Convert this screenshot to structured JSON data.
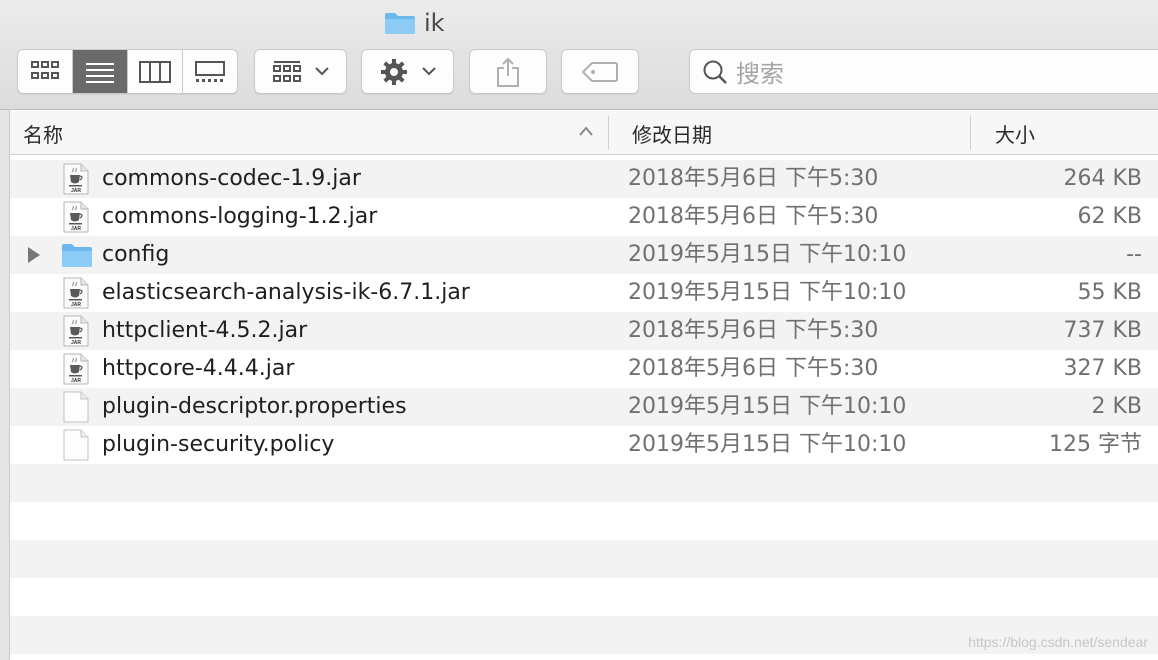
{
  "window": {
    "title": "ik",
    "title_icon": "folder-icon"
  },
  "toolbar": {
    "view_modes": [
      {
        "name": "icon-view",
        "icon": "grid-icon",
        "active": false
      },
      {
        "name": "list-view",
        "icon": "list-icon",
        "active": true
      },
      {
        "name": "column-view",
        "icon": "columns-icon",
        "active": false
      },
      {
        "name": "gallery-view",
        "icon": "gallery-icon",
        "active": false
      }
    ],
    "group_icon": "group-icon",
    "action_icon": "gear-icon",
    "share_icon": "share-icon",
    "tag_icon": "tag-icon",
    "search_placeholder": "搜索"
  },
  "columns": {
    "name": "名称",
    "date": "修改日期",
    "size": "大小"
  },
  "files": [
    {
      "name": "commons-codec-1.9.jar",
      "date": "2018年5月6日 下午5:30",
      "size": "264 KB",
      "kind": "jar"
    },
    {
      "name": "commons-logging-1.2.jar",
      "date": "2018年5月6日 下午5:30",
      "size": "62 KB",
      "kind": "jar"
    },
    {
      "name": "config",
      "date": "2019年5月15日 下午10:10",
      "size": "--",
      "kind": "folder"
    },
    {
      "name": "elasticsearch-analysis-ik-6.7.1.jar",
      "date": "2019年5月15日 下午10:10",
      "size": "55 KB",
      "kind": "jar"
    },
    {
      "name": "httpclient-4.5.2.jar",
      "date": "2018年5月6日 下午5:30",
      "size": "737 KB",
      "kind": "jar"
    },
    {
      "name": "httpcore-4.4.4.jar",
      "date": "2018年5月6日 下午5:30",
      "size": "327 KB",
      "kind": "jar"
    },
    {
      "name": "plugin-descriptor.properties",
      "date": "2019年5月15日 下午10:10",
      "size": "2 KB",
      "kind": "document"
    },
    {
      "name": "plugin-security.policy",
      "date": "2019年5月15日 下午10:10",
      "size": "125 字节",
      "kind": "document"
    }
  ],
  "watermark": "https://blog.csdn.net/sendear",
  "colors": {
    "folder": "#6cb8ee",
    "selected_view": "#6a6a6a",
    "row_alt": "#f3f3f3"
  }
}
